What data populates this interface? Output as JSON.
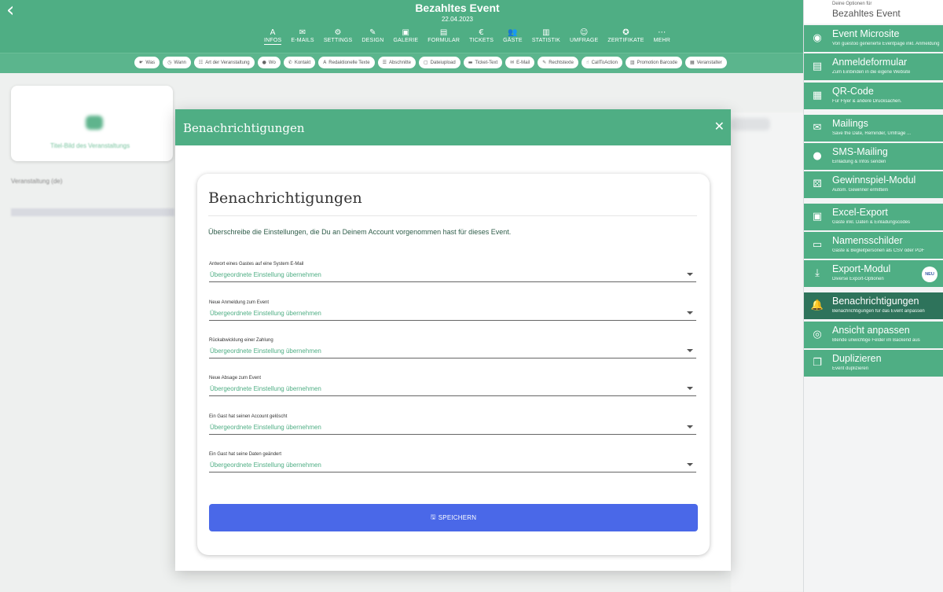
{
  "header": {
    "back_icon": "chevron-left-icon",
    "title": "Bezahltes Event",
    "date": "22.04.2023",
    "tabs": [
      {
        "label": "INFOS",
        "icon": "A",
        "active": true
      },
      {
        "label": "E-MAILS",
        "icon": "✉"
      },
      {
        "label": "SETTINGS",
        "icon": "⚙"
      },
      {
        "label": "DESIGN",
        "icon": "✎"
      },
      {
        "label": "GALERIE",
        "icon": "▣"
      },
      {
        "label": "FORMULAR",
        "icon": "▤"
      },
      {
        "label": "TICKETS",
        "icon": "€"
      },
      {
        "label": "GÄSTE",
        "icon": "👥"
      },
      {
        "label": "STATISTIK",
        "icon": "▥"
      },
      {
        "label": "UMFRAGE",
        "icon": "☺"
      },
      {
        "label": "ZERTIFIKATE",
        "icon": "✪"
      },
      {
        "label": "MEHR",
        "icon": "⋯"
      }
    ]
  },
  "chips": [
    {
      "label": "Was",
      "icon": "☛"
    },
    {
      "label": "Wann",
      "icon": "◷"
    },
    {
      "label": "Art der Veranstaltung",
      "icon": "☷"
    },
    {
      "label": "Wo",
      "icon": "●"
    },
    {
      "label": "Kontakt",
      "icon": "✆"
    },
    {
      "label": "Redaktionelle Texte",
      "icon": "A"
    },
    {
      "label": "Abschnitte",
      "icon": "☰"
    },
    {
      "label": "Dateiupload",
      "icon": "▢"
    },
    {
      "label": "Ticket-Text",
      "icon": "▬"
    },
    {
      "label": "E-Mail",
      "icon": "✉"
    },
    {
      "label": "Rechtstexte",
      "icon": "✎"
    },
    {
      "label": "CallToAction",
      "icon": "☝"
    },
    {
      "label": "Promotion Barcode",
      "icon": "▥"
    },
    {
      "label": "Veranstalter",
      "icon": "▦"
    }
  ],
  "modal": {
    "title": "Benachrichtigungen",
    "close_icon": "close-icon",
    "card_title": "Benachrichtigungen",
    "description": "Überschreibe die Einstellungen, die Du an Deinem Account vorgenommen hast für dieses Event.",
    "fields": [
      {
        "label": "Antwort eines Gastes auf eine System E-Mail",
        "value": "Übergeordnete Einstellung übernehmen"
      },
      {
        "label": "Neue Anmeldung zum Event",
        "value": "Übergeordnete Einstellung übernehmen"
      },
      {
        "label": "Rückabwicklung einer Zahlung",
        "value": "Übergeordnete Einstellung übernehmen"
      },
      {
        "label": "Neue Absage zum Event",
        "value": "Übergeordnete Einstellung übernehmen"
      },
      {
        "label": "Ein Gast hat seinen Account gelöscht",
        "value": "Übergeordnete Einstellung übernehmen"
      },
      {
        "label": "Ein Gast hat seine Daten geändert",
        "value": "Übergeordnete Einstellung übernehmen"
      }
    ],
    "save_label": "SPEICHERN",
    "save_icon": "save-icon"
  },
  "right_panel": {
    "subtitle": "Deine Optionen für",
    "title": "Bezahltes Event",
    "items": [
      {
        "title": "Event Microsite",
        "sub": "Von guestoo generierte Eventpage inkl. Anmeldung",
        "icon": "eye-icon",
        "glyph": "◉"
      },
      {
        "title": "Anmeldeformular",
        "sub": "Zum Einbinden in die eigene Website",
        "icon": "code-file-icon",
        "glyph": "▤"
      },
      {
        "title": "QR-Code",
        "sub": "Für Flyer & andere Drucksachen.",
        "icon": "qr-code-icon",
        "glyph": "▦"
      },
      {
        "title": "Mailings",
        "sub": "Save the Date, Reminder, Umfrage ...",
        "icon": "envelope-open-icon",
        "glyph": "✉"
      },
      {
        "title": "SMS-Mailing",
        "sub": "Einladung & Infos senden",
        "icon": "sms-icon",
        "glyph": "●"
      },
      {
        "title": "Gewinnspiel-Modul",
        "sub": "Autom. Gewinner ermitteln",
        "icon": "dice-icon",
        "glyph": "⚄"
      },
      {
        "title": "Excel-Export",
        "sub": "Gäste inkl. Daten & Einladungscodes",
        "icon": "excel-file-icon",
        "glyph": "▣"
      },
      {
        "title": "Namensschilder",
        "sub": "Gäste & Begleitpersonen als CSV oder PDF",
        "icon": "id-card-icon",
        "glyph": "▭"
      },
      {
        "title": "Export-Modul",
        "sub": "Diverse Export-Optionen",
        "icon": "download-icon",
        "glyph": "⤓",
        "badge": "NEU"
      },
      {
        "title": "Benachrichtigungen",
        "sub": "Benachrichtigungen für das Event anpassen",
        "icon": "bell-icon",
        "glyph": "🔔",
        "active": true
      },
      {
        "title": "Ansicht anpassen",
        "sub": "Blende unwichtige Felder im Backend aus",
        "icon": "eye-slash-icon",
        "glyph": "◎"
      },
      {
        "title": "Duplizieren",
        "sub": "Event duplizieren",
        "icon": "copy-icon",
        "glyph": "❐"
      }
    ]
  },
  "background": {
    "card_text": "Titel-Bild des Veranstaltungs",
    "label": "Veranstaltung (de)"
  }
}
